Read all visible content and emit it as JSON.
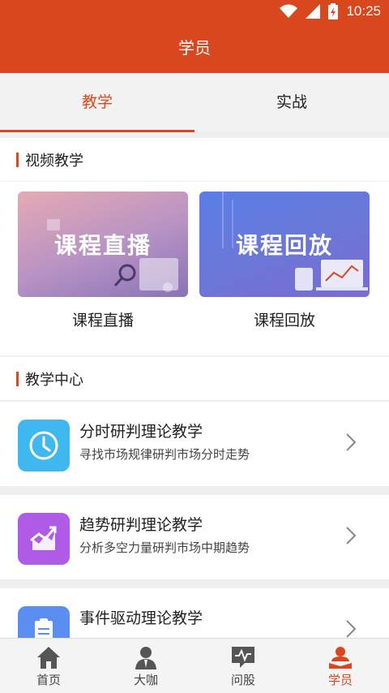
{
  "status": {
    "time": "10:25"
  },
  "header": {
    "title": "学员"
  },
  "tabs": [
    {
      "label": "教学",
      "active": true
    },
    {
      "label": "实战",
      "active": false
    }
  ],
  "video_section": {
    "title": "视频教学",
    "cards": [
      {
        "thumb_text": "课程直播",
        "label": "课程直播"
      },
      {
        "thumb_text": "课程回放",
        "label": "课程回放"
      }
    ]
  },
  "teaching_center": {
    "title": "教学中心",
    "items": [
      {
        "title": "分时研判理论教学",
        "subtitle": "寻找市场规律研判市场分时走势",
        "icon": "clock-icon",
        "color": "#3fb8f0"
      },
      {
        "title": "趋势研判理论教学",
        "subtitle": "分析多空力量研判市场中期趋势",
        "icon": "trend-chart-icon",
        "color": "#b05ae8"
      },
      {
        "title": "事件驱动理论教学",
        "subtitle": "",
        "icon": "document-icon",
        "color": "#5a8ef0"
      }
    ]
  },
  "bottom_nav": [
    {
      "label": "首页",
      "icon": "home-icon",
      "active": false
    },
    {
      "label": "大咖",
      "icon": "expert-icon",
      "active": false
    },
    {
      "label": "问股",
      "icon": "stock-chat-icon",
      "active": false
    },
    {
      "label": "学员",
      "icon": "student-icon",
      "active": true
    }
  ],
  "colors": {
    "accent": "#d9471e"
  }
}
